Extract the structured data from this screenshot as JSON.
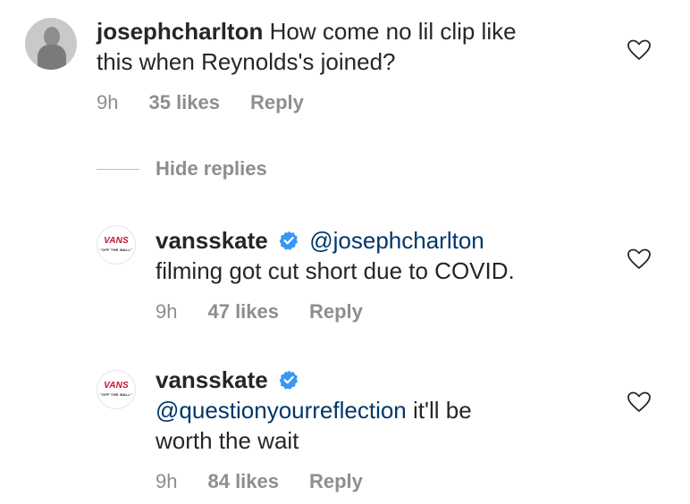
{
  "comments": [
    {
      "username": "josephcharlton",
      "mention": "",
      "body": " How come no lil clip like",
      "body_line2": "this when Reynolds's joined?",
      "time": "9h",
      "likes": "35 likes",
      "reply": "Reply"
    },
    {
      "username": "vansskate",
      "mention": "@josephcharlton",
      "body": "filming got cut short due to COVID.",
      "time": "9h",
      "likes": "47 likes",
      "reply": "Reply"
    },
    {
      "username": "vansskate",
      "mention": "@questionyourreflection",
      "body": " it'll be",
      "body_line2": "worth the wait",
      "time": "9h",
      "likes": "84 likes",
      "reply": "Reply"
    }
  ],
  "hide_replies": "Hide replies",
  "avatar_logo": {
    "brand": "VANS",
    "tagline": "\"OFF THE WALL\""
  },
  "colors": {
    "mention": "#00376b",
    "meta": "#8e8e8e",
    "verified": "#3897f0",
    "text": "#262626"
  }
}
